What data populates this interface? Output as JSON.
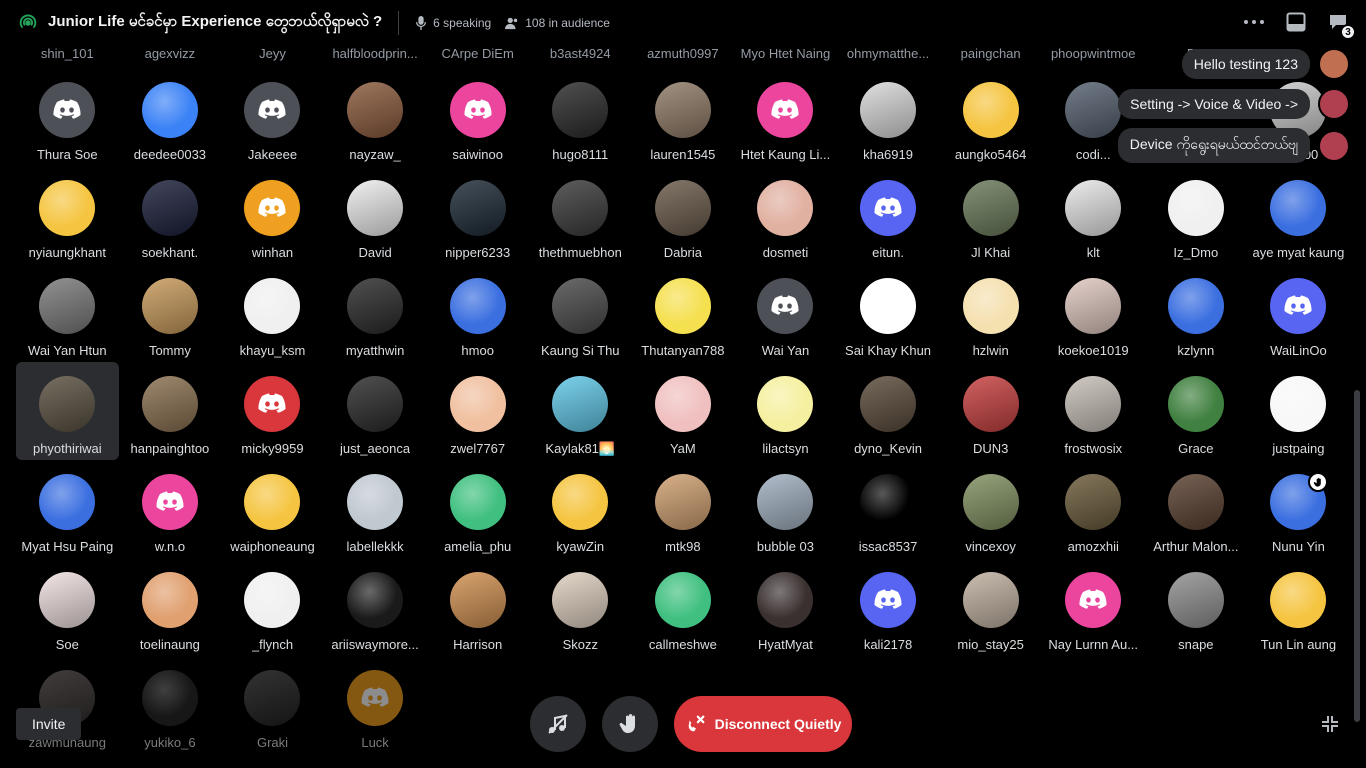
{
  "header": {
    "title": "Junior Life မင်ခင်မှာ Experience တွေဘယ်လိုရှာမလဲ ?",
    "speaking": "6 speaking",
    "audience": "108 in audience",
    "inbox_count": "3",
    "icons": [
      "stage-icon",
      "microphone-icon",
      "people-icon",
      "more-icon",
      "chat-icon",
      "inbox-icon"
    ]
  },
  "partial_row": [
    "shin_101",
    "agexvizz",
    "Jeyy",
    "halfbloodprin...",
    "CArpe DiEm",
    "b3ast4924",
    "azmuth0997",
    "Myo Htet Naing",
    "ohmymatthe...",
    "paingchan",
    "phoopwintmoe",
    "P...",
    "..."
  ],
  "rows": [
    [
      {
        "name": "Thura Soe",
        "bg": "#4e5058",
        "kind": "discord"
      },
      {
        "name": "deedee0033",
        "bg": "#3b82f6",
        "kind": "art"
      },
      {
        "name": "Jakeeee",
        "bg": "#4e5058",
        "kind": "discord"
      },
      {
        "name": "nayzaw_",
        "bg": "#8a5a3c",
        "kind": "photo"
      },
      {
        "name": "saiwinoo",
        "bg": "#eb459e",
        "kind": "discord"
      },
      {
        "name": "hugo8111",
        "bg": "#2a2a2a",
        "kind": "photo"
      },
      {
        "name": "lauren1545",
        "bg": "#8f7a66",
        "kind": "photo"
      },
      {
        "name": "Htet Kaung Li...",
        "bg": "#eb459e",
        "kind": "discord"
      },
      {
        "name": "kha6919",
        "bg": "#d9d9d9",
        "kind": "photo"
      },
      {
        "name": "aungko5464",
        "bg": "#f5c542",
        "kind": "art"
      },
      {
        "name": "codi...",
        "bg": "#556070",
        "kind": "photo"
      },
      {
        "name": "",
        "bg": "#000000",
        "kind": "hidden"
      },
      {
        "name": "...9000",
        "bg": "#c9c9c9",
        "kind": "photo"
      }
    ],
    [
      {
        "name": "nyiaungkhant",
        "bg": "#f5c542",
        "kind": "art"
      },
      {
        "name": "soekhant.",
        "bg": "#1a1f3a",
        "kind": "photo"
      },
      {
        "name": "winhan",
        "bg": "#f0a020",
        "kind": "discord"
      },
      {
        "name": "David",
        "bg": "#eeeeee",
        "kind": "photo"
      },
      {
        "name": "nipper6233",
        "bg": "#1d2a36",
        "kind": "photo"
      },
      {
        "name": "thethmuebhon",
        "bg": "#3a3a3a",
        "kind": "photo"
      },
      {
        "name": "Dabria",
        "bg": "#6a5a4a",
        "kind": "photo"
      },
      {
        "name": "dosmeti",
        "bg": "#e0b0a0",
        "kind": "art"
      },
      {
        "name": "eitun.",
        "bg": "#5865f2",
        "kind": "discord"
      },
      {
        "name": "Jl Khai",
        "bg": "#6a7a5a",
        "kind": "photo"
      },
      {
        "name": "klt",
        "bg": "#e8e8e8",
        "kind": "photo"
      },
      {
        "name": "Iz_Dmo",
        "bg": "#f0f0f0",
        "kind": "art"
      },
      {
        "name": "aye myat kaung",
        "bg": "#3b6fe0",
        "kind": "art"
      }
    ],
    [
      {
        "name": "Wai Yan Htun",
        "bg": "#7a7a7a",
        "kind": "photo"
      },
      {
        "name": "Tommy",
        "bg": "#c89a5a",
        "kind": "photo"
      },
      {
        "name": "khayu_ksm",
        "bg": "#f0f0f0",
        "kind": "art"
      },
      {
        "name": "myatthwin",
        "bg": "#2a2a2a",
        "kind": "photo"
      },
      {
        "name": "hmoo",
        "bg": "#3b6fe0",
        "kind": "art"
      },
      {
        "name": "Kaung Si Thu",
        "bg": "#4a4a4a",
        "kind": "photo"
      },
      {
        "name": "Thutanyan788",
        "bg": "#f5e050",
        "kind": "art"
      },
      {
        "name": "Wai Yan",
        "bg": "#4e5058",
        "kind": "discord"
      },
      {
        "name": "Sai Khay Khun",
        "bg": "#ffffff",
        "kind": "art"
      },
      {
        "name": "hzlwin",
        "bg": "#f5e0b0",
        "kind": "art"
      },
      {
        "name": "koekoe1019",
        "bg": "#e0c8c0",
        "kind": "photo"
      },
      {
        "name": "kzlynn",
        "bg": "#3b6fe0",
        "kind": "art"
      },
      {
        "name": "WaiLinOo",
        "bg": "#5865f2",
        "kind": "discord"
      }
    ],
    [
      {
        "name": "phyothiriwai",
        "bg": "#5a5040",
        "kind": "photo",
        "selected": true
      },
      {
        "name": "hanpainghtoo",
        "bg": "#8a7050",
        "kind": "photo"
      },
      {
        "name": "micky9959",
        "bg": "#da373c",
        "kind": "discord"
      },
      {
        "name": "just_aeonca",
        "bg": "#2a2a2a",
        "kind": "photo"
      },
      {
        "name": "zwel7767",
        "bg": "#f0c0a0",
        "kind": "art"
      },
      {
        "name": "Kaylak81🌅",
        "bg": "#60c8e8",
        "kind": "photo"
      },
      {
        "name": "YaM",
        "bg": "#f0c0c0",
        "kind": "art"
      },
      {
        "name": "lilactsyn",
        "bg": "#f5f0a0",
        "kind": "art"
      },
      {
        "name": "dyno_Kevin",
        "bg": "#5a4a3a",
        "kind": "photo"
      },
      {
        "name": "DUN3",
        "bg": "#c84040",
        "kind": "photo"
      },
      {
        "name": "frostwosix",
        "bg": "#c8c0b8",
        "kind": "photo"
      },
      {
        "name": "Grace",
        "bg": "#408040",
        "kind": "art"
      },
      {
        "name": "justpaing",
        "bg": "#f8f8f8",
        "kind": "art"
      }
    ],
    [
      {
        "name": "Myat Hsu Paing",
        "bg": "#3b6fe0",
        "kind": "art"
      },
      {
        "name": "w.n.o",
        "bg": "#eb459e",
        "kind": "discord"
      },
      {
        "name": "waiphoneaung",
        "bg": "#f5c542",
        "kind": "art"
      },
      {
        "name": "labellekkk",
        "bg": "#c0c8d0",
        "kind": "art"
      },
      {
        "name": "amelia_phu",
        "bg": "#40c080",
        "kind": "art"
      },
      {
        "name": "kyawZin",
        "bg": "#f5c542",
        "kind": "art"
      },
      {
        "name": "mtk98",
        "bg": "#d0a070",
        "kind": "photo"
      },
      {
        "name": "bubble 03",
        "bg": "#a0b0c0",
        "kind": "photo"
      },
      {
        "name": "issac8537",
        "bg": "#000000",
        "kind": "art"
      },
      {
        "name": "vincexoy",
        "bg": "#809060",
        "kind": "photo"
      },
      {
        "name": "amozxhii",
        "bg": "#6a5a3a",
        "kind": "photo"
      },
      {
        "name": "Arthur Malon...",
        "bg": "#5a4030",
        "kind": "photo"
      },
      {
        "name": "Nunu Yin",
        "bg": "#3b6fe0",
        "kind": "art",
        "hand": true
      }
    ],
    [
      {
        "name": "Soe",
        "bg": "#f0e0e0",
        "kind": "photo"
      },
      {
        "name": "toelinaung",
        "bg": "#e0a070",
        "kind": "art"
      },
      {
        "name": "_flynch",
        "bg": "#f0f0f0",
        "kind": "art"
      },
      {
        "name": "ariiswaymore...",
        "bg": "#1a1a1a",
        "kind": "art"
      },
      {
        "name": "Harrison",
        "bg": "#d09050",
        "kind": "photo"
      },
      {
        "name": "Skozz",
        "bg": "#e0d0c0",
        "kind": "photo"
      },
      {
        "name": "callmeshwe",
        "bg": "#40c080",
        "kind": "art"
      },
      {
        "name": "HyatMyat",
        "bg": "#3a3030",
        "kind": "art"
      },
      {
        "name": "kali2178",
        "bg": "#5865f2",
        "kind": "discord"
      },
      {
        "name": "mio_stay25",
        "bg": "#c0b0a0",
        "kind": "photo"
      },
      {
        "name": "Nay Lurnn Au...",
        "bg": "#eb459e",
        "kind": "discord"
      },
      {
        "name": "snape",
        "bg": "#909090",
        "kind": "photo"
      },
      {
        "name": "Tun Lin aung",
        "bg": "#f5c542",
        "kind": "art"
      }
    ],
    [
      {
        "name": "zawmunaung",
        "bg": "#5a5050",
        "kind": "photo"
      },
      {
        "name": "yukiko_6",
        "bg": "#2a2a2a",
        "kind": "art"
      },
      {
        "name": "Graki",
        "bg": "#3a3a3a",
        "kind": "photo"
      },
      {
        "name": "Luck",
        "bg": "#f0a020",
        "kind": "discord"
      }
    ]
  ],
  "toasts": [
    {
      "text": "Hello testing 123",
      "color": "#c07050"
    },
    {
      "text": "Setting -> Voice & Video ->",
      "color": "#b04050"
    },
    {
      "text": "Device ကိုရွေးရမယ်ထင်တယ်ဗျ",
      "color": "#b04050"
    }
  ],
  "controls": {
    "invite_label": "Invite",
    "disconnect_label": "Disconnect Quietly",
    "icons": [
      "deafen-icon",
      "raise-hand-icon",
      "disconnect-icon",
      "fullscreen-icon"
    ]
  },
  "colors": {
    "discord_blurple": "#5865f2",
    "danger": "#da373c",
    "surface": "#2b2d31"
  }
}
